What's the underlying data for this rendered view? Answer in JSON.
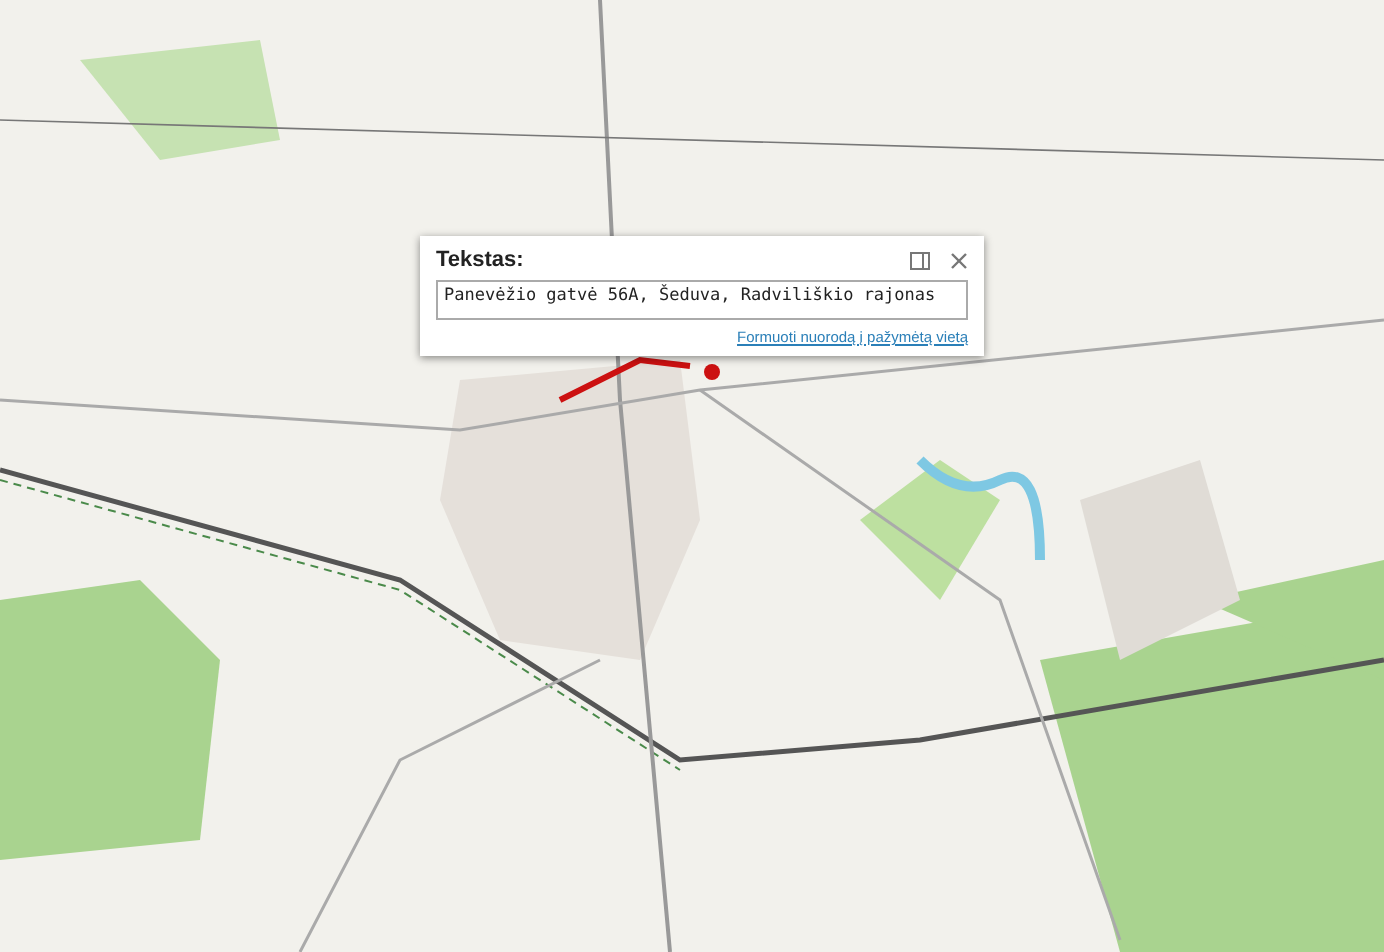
{
  "popup": {
    "title": "Tekstas:",
    "value": "Panevėžio gatvė 56A, Šeduva, Radviliškio rajonas",
    "link": "Formuoti nuorodą į pažymėtą vietą"
  }
}
